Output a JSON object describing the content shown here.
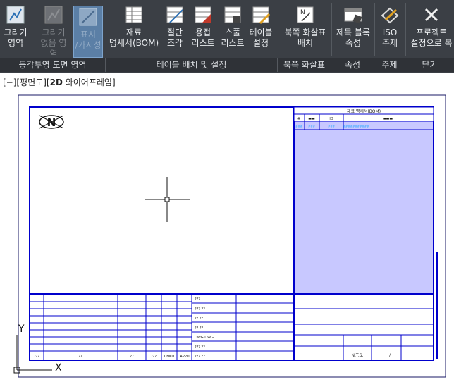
{
  "ribbon": {
    "buttons": {
      "draw_area": "그리기\n영역",
      "draw_no_area": "그리기\n없음 영역",
      "show_hide": "표시\n/가시성",
      "bom": "재료\n명세서(BOM)",
      "section_cut": "절단\n조각",
      "weld_list": "용접\n리스트",
      "spool_list": "스풀\n리스트",
      "table_settings": "테이블\n설정",
      "north_arrow_place": "북쪽 화살표\n배치",
      "title_block_attr": "제목 블록\n속성",
      "iso_annotation": "ISO\n주제",
      "close_project": "프로젝트\n설정으로 복"
    },
    "panels": {
      "iso_area": "등각투영 도면 영역",
      "table_place": "테이블 배치 및 설정",
      "north_arrow": "북쪽 화살표",
      "attributes": "속성",
      "annotation": "주제",
      "close": "닫기"
    }
  },
  "viewport": {
    "label_bracket": "[−][평면도][",
    "label_bold": "2D",
    "label_rest": " 와이어프레임]"
  },
  "drawing": {
    "north_letter": "N",
    "bom_title": "재료 명세서(BOM)",
    "bom_headers": [
      "#",
      "▬▬",
      "ID",
      "▬▬▬"
    ],
    "bom_row": [
      "###",
      "###",
      "###",
      "###########"
    ],
    "title_rows": [
      "???",
      "??? ??",
      "?? ??",
      "?? ??",
      "DWG DWG",
      "??? ??",
      "??? ??"
    ],
    "rev_headers": [
      "???",
      "??",
      "??",
      "???",
      "CHKD",
      "APPD"
    ],
    "scale": "N.T.S.",
    "sheet": "/",
    "ucs_y": "Y",
    "ucs_x": "X"
  },
  "colors": {
    "ribbon_bg": "#3b3f45",
    "frame_blue": "#0000cc",
    "bom_fill": "#c8c8ff",
    "active_btn": "#5b7fa6"
  }
}
